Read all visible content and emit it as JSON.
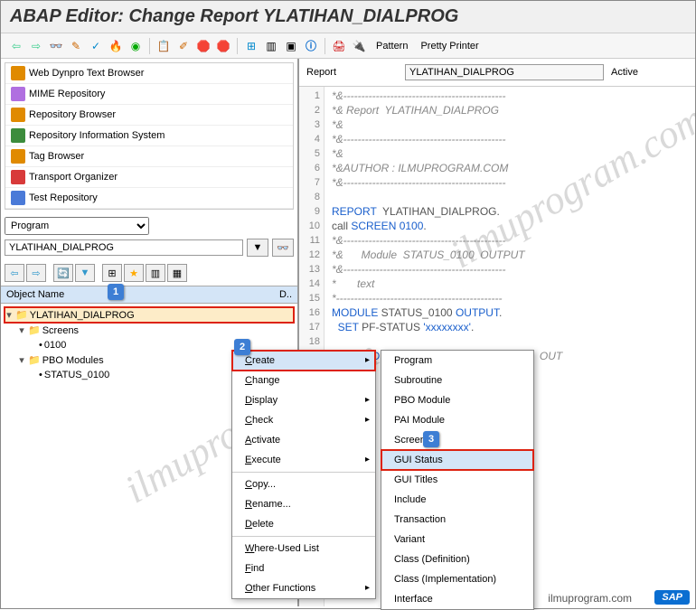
{
  "window": {
    "title": "ABAP Editor: Change Report YLATIHAN_DIALPROG"
  },
  "toolbar": {
    "pattern_label": "Pattern",
    "pretty_label": "Pretty Printer"
  },
  "nav": {
    "items": [
      {
        "label": "Web Dynpro Text Browser",
        "color": "#e08a00"
      },
      {
        "label": "MIME Repository",
        "color": "#b06fe0"
      },
      {
        "label": "Repository Browser",
        "color": "#e08a00"
      },
      {
        "label": "Repository Information System",
        "color": "#3c8c3c"
      },
      {
        "label": "Tag Browser",
        "color": "#e08a00"
      },
      {
        "label": "Transport Organizer",
        "color": "#d83a3a"
      },
      {
        "label": "Test Repository",
        "color": "#4a7ad8"
      }
    ]
  },
  "selector": {
    "type_label": "Program",
    "value": "YLATIHAN_DIALPROG"
  },
  "tree": {
    "header_name": "Object Name",
    "header_desc": "D..",
    "root": "YLATIHAN_DIALPROG",
    "children": [
      {
        "label": "Screens",
        "children": [
          {
            "label": "0100"
          }
        ]
      },
      {
        "label": "PBO Modules",
        "children": [
          {
            "label": "STATUS_0100"
          }
        ]
      }
    ]
  },
  "report": {
    "label": "Report",
    "name": "YLATIHAN_DIALPROG",
    "status": "Active"
  },
  "code": {
    "lines": [
      "*&---------------------------------------------",
      "*& Report  YLATIHAN_DIALPROG",
      "*&",
      "*&---------------------------------------------",
      "*&",
      "*&AUTHOR : ILMUPROGRAM.COM",
      "*&---------------------------------------------",
      "",
      "REPORT  YLATIHAN_DIALPROG.",
      "call SCREEN 0100.",
      "*&---------------------------------------------",
      "*&      Module  STATUS_0100  OUTPUT",
      "*&---------------------------------------------",
      "*       text",
      "*----------------------------------------------",
      "MODULE STATUS_0100 OUTPUT.",
      "  SET PF-STATUS 'xxxxxxxx'.",
      "",
      "ENDMODULE.                 \" STATUS_0100  OUT"
    ]
  },
  "context_menu_1": {
    "items": [
      "Create",
      "Change",
      "Display",
      "Check",
      "Activate",
      "Execute",
      "Copy...",
      "Rename...",
      "Delete",
      "Where-Used List",
      "Find",
      "Other Functions"
    ],
    "submenu_flags": [
      true,
      false,
      true,
      true,
      false,
      true,
      false,
      false,
      false,
      false,
      false,
      true
    ]
  },
  "context_menu_2": {
    "items": [
      "Program",
      "Subroutine",
      "PBO Module",
      "PAI Module",
      "Screen",
      "GUI Status",
      "GUI Titles",
      "Include",
      "Transaction",
      "Variant",
      "Class (Definition)",
      "Class (Implementation)",
      "Interface"
    ]
  },
  "callouts": {
    "c1": "1",
    "c2": "2",
    "c3": "3"
  },
  "footer": {
    "text": "ilmuprogram.com",
    "logo": "SAP"
  }
}
